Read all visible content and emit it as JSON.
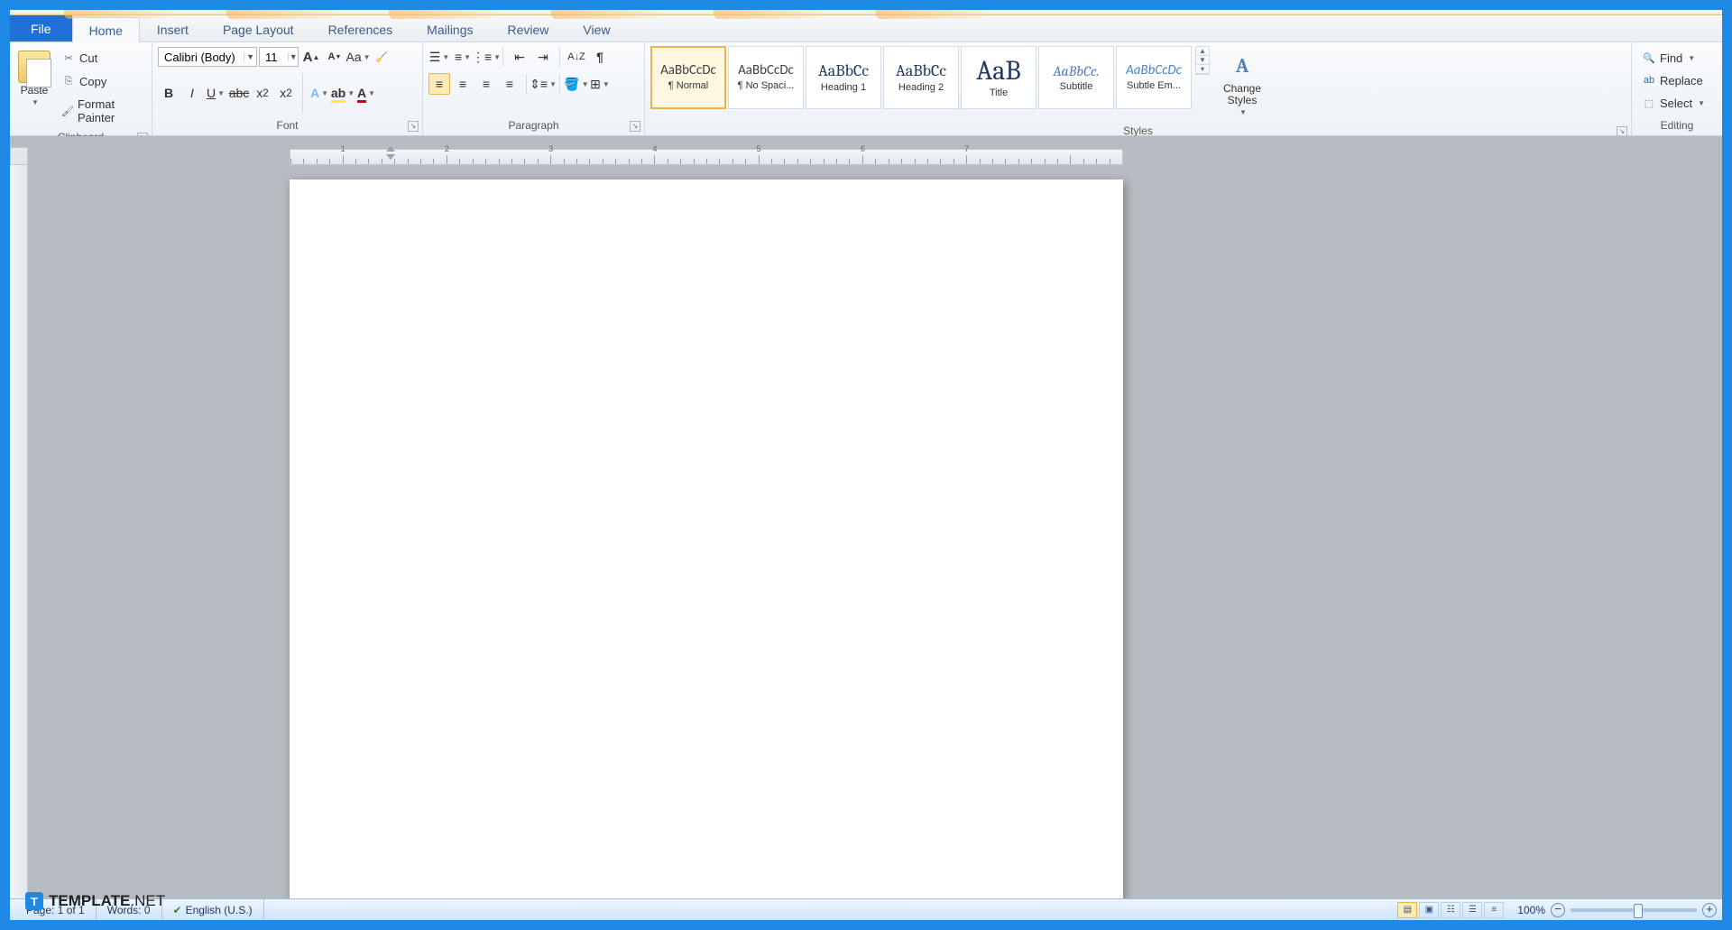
{
  "tabs": {
    "file": "File",
    "home": "Home",
    "insert": "Insert",
    "page_layout": "Page Layout",
    "references": "References",
    "mailings": "Mailings",
    "review": "Review",
    "view": "View"
  },
  "clipboard": {
    "paste": "Paste",
    "cut": "Cut",
    "copy": "Copy",
    "format_painter": "Format Painter",
    "group": "Clipboard"
  },
  "font": {
    "name": "Calibri (Body)",
    "size": "11",
    "group": "Font"
  },
  "paragraph": {
    "group": "Paragraph"
  },
  "styles": {
    "group": "Styles",
    "items": [
      {
        "sample": "AaBbCcDc",
        "name": "¶ Normal",
        "cls": "gray",
        "size": "15px"
      },
      {
        "sample": "AaBbCcDc",
        "name": "¶ No Spaci...",
        "cls": "gray",
        "size": "15px"
      },
      {
        "sample": "AaBbCc",
        "name": "Heading 1",
        "cls": "",
        "size": "18px"
      },
      {
        "sample": "AaBbCc",
        "name": "Heading 2",
        "cls": "",
        "size": "18px"
      },
      {
        "sample": "AaB",
        "name": "Title",
        "cls": "",
        "size": "30px"
      },
      {
        "sample": "AaBbCc.",
        "name": "Subtitle",
        "cls": "italic",
        "size": "16px"
      },
      {
        "sample": "AaBbCcDc",
        "name": "Subtle Em...",
        "cls": "italic gray",
        "size": "15px"
      }
    ],
    "change": "Change Styles"
  },
  "editing": {
    "find": "Find",
    "replace": "Replace",
    "select": "Select",
    "group": "Editing"
  },
  "status": {
    "page": "Page: 1 of 1",
    "words": "Words: 0",
    "lang": "English (U.S.)",
    "zoom": "100%"
  },
  "brand": {
    "t": "T",
    "bold": "TEMPLATE",
    "rest": ".NET"
  },
  "ruler": {
    "marks": [
      "1",
      "2",
      "3",
      "4",
      "5",
      "6",
      "7"
    ]
  }
}
